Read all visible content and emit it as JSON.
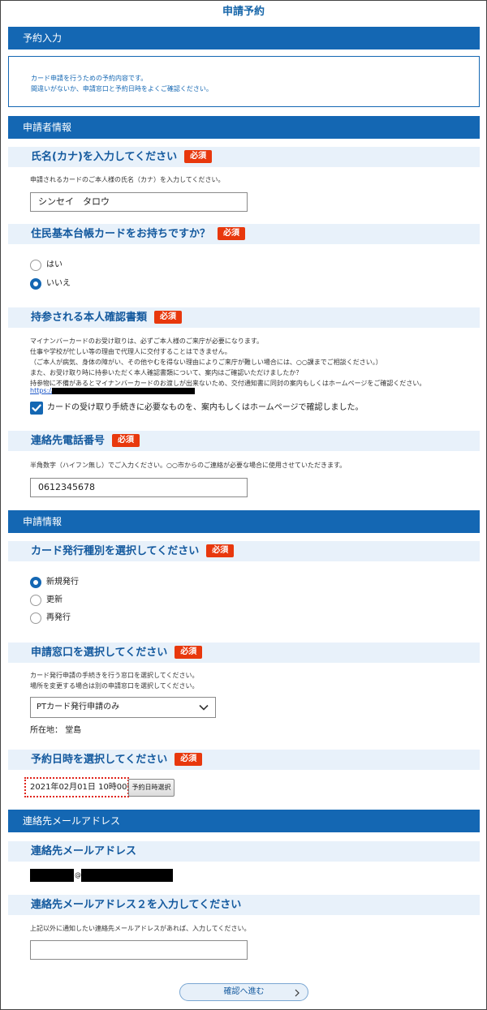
{
  "page_title": "申請予約",
  "sections": {
    "reservation": {
      "title": "予約入力",
      "info": [
        "カード申請を行うための予約内容です。",
        "間違いがないか、申請窓口と予約日時をよくご確認ください。"
      ]
    },
    "applicant": {
      "title": "申請者情報"
    },
    "application": {
      "title": "申請情報"
    },
    "email_section": {
      "title": "連絡先メールアドレス"
    }
  },
  "required_label": "必須",
  "name_kana": {
    "label": "氏名(カナ)を入力してください",
    "note": "申請されるカードのご本人様の氏名（カナ）を入力してください。",
    "value": "シンセイ　タロウ"
  },
  "resident_card": {
    "label": "住民基本台帳カードをお持ちですか？",
    "options": [
      "はい",
      "いいえ"
    ],
    "selected": "いいえ"
  },
  "id_documents": {
    "label": "持参される本人確認書類",
    "notes": [
      "マイナンバーカードのお受け取りは、必ずご本人様のご来庁が必要になります。",
      "仕事や学校が忙しい等の理由で代理人に交付することはできません。",
      "（ご本人が病気、身体の障がい、その他やむを得ない理由によりご来庁が難しい場合には、○○課までご相談ください。）",
      "また、お受け取り時に持参いただく本人確認書類について、案内はご確認いただけましたか？",
      "持参物に不備があるとマイナンバーカードのお渡しが出来ないため、交付通知書に同封の案内もしくはホームページをご確認ください。"
    ],
    "link_prefix": "https://",
    "checkbox_label": "カードの受け取り手続きに必要なものを、案内もしくはホームページで確認しました。",
    "checked": true
  },
  "phone": {
    "label": "連絡先電話番号",
    "note": "半角数字（ハイフン無し）でご入力ください。○○市からのご連絡が必要な場合に使用させていただきます。",
    "value": "0612345678"
  },
  "card_type": {
    "label": "カード発行種別を選択してください",
    "options": [
      "新規発行",
      "更新",
      "再発行"
    ],
    "selected": "新規発行"
  },
  "window": {
    "label": "申請窓口を選択してください",
    "notes": [
      "カード発行申請の手続きを行う窓口を選択してください。",
      "場所を変更する場合は別の申請窓口を選択してください。"
    ],
    "selected": "PTカード発行申請のみ",
    "location_label": "所在地：",
    "location_value": "堂島"
  },
  "datetime": {
    "label": "予約日時を選択してください",
    "value": "2021年02月01日 10時00分",
    "button": "予約日時選択"
  },
  "email": {
    "label": "連絡先メールアドレス",
    "at": "@"
  },
  "email2": {
    "label": "連絡先メールアドレス２を入力してください",
    "note": "上記以外に通知したい連絡先メールアドレスがあれば、入力してください。",
    "value": ""
  },
  "submit": {
    "label": "確認へ進む"
  },
  "colors": {
    "primary": "#1467b3",
    "required": "#e8380d",
    "sub_bar": "#e8f1fa",
    "error_outline": "#e0231a"
  }
}
